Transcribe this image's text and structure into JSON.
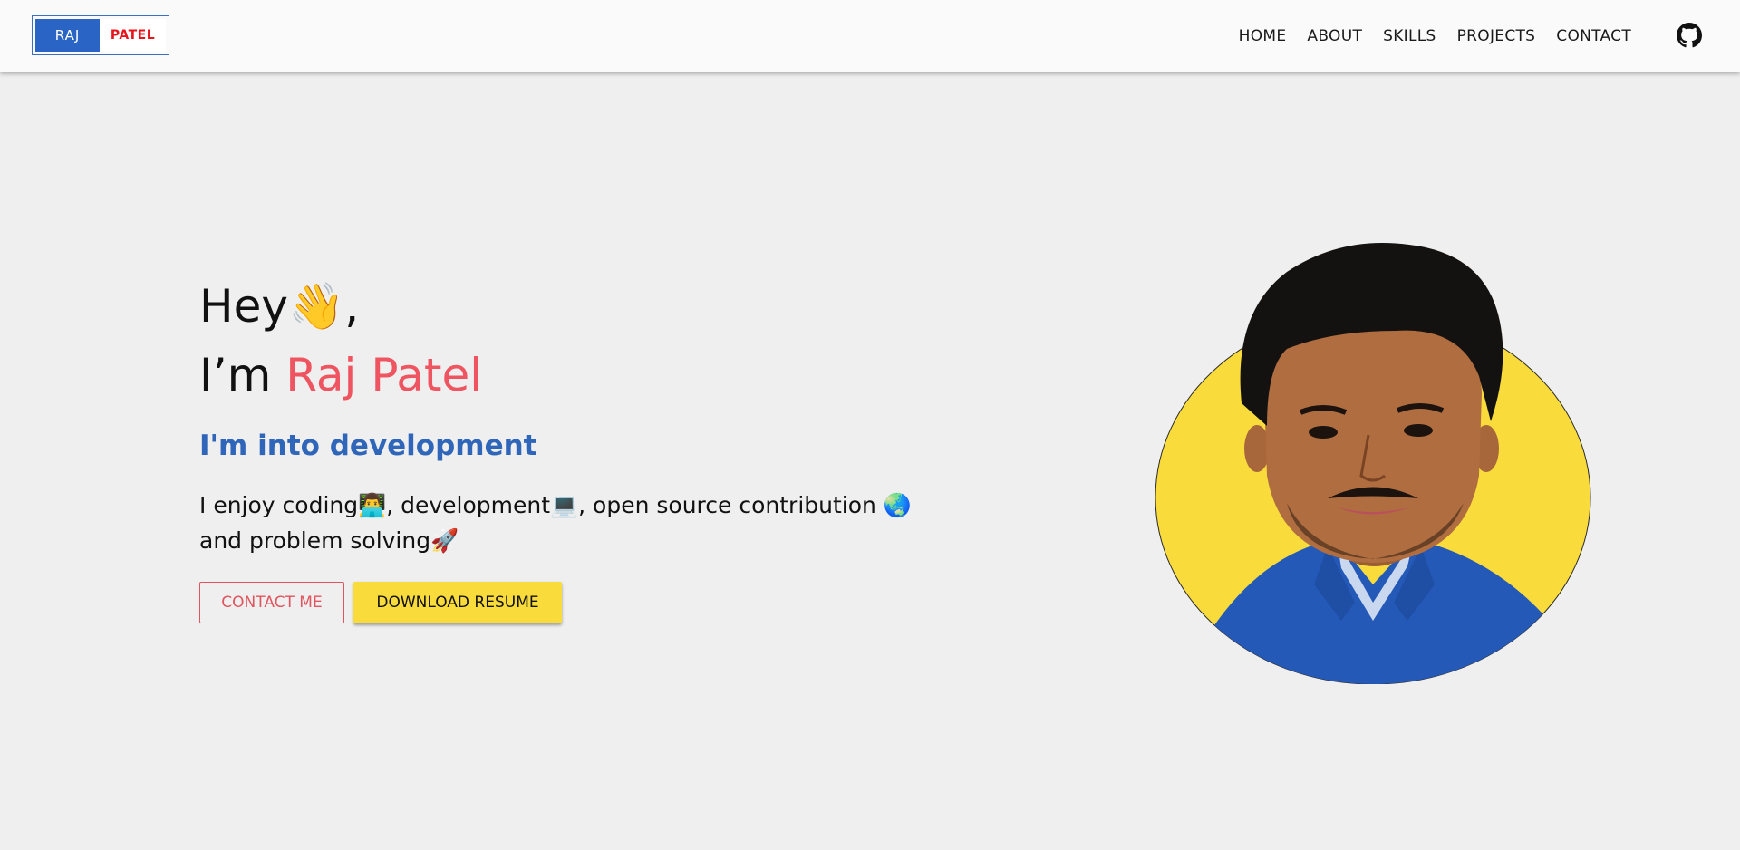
{
  "header": {
    "logo": {
      "left": "RAJ",
      "right": "PATEL"
    },
    "nav": [
      "HOME",
      "ABOUT",
      "SKILLS",
      "PROJECTS",
      "CONTACT"
    ],
    "github_icon": "github-icon"
  },
  "hero": {
    "greeting": "Hey",
    "greeting_emoji": "👋",
    "greeting_suffix": ",",
    "intro_prefix": "I’m ",
    "name": "Raj Patel",
    "tagline": "I'm into development",
    "description": "I enjoy coding👨‍💻, development💻, open source contribution 🌏 and problem solving🚀",
    "buttons": {
      "contact": "CONTACT ME",
      "resume": "DOWNLOAD RESUME"
    }
  },
  "colors": {
    "background": "#efefef",
    "header": "#fafafa",
    "logo_blue": "#2a65c5",
    "logo_red": "#e8141b",
    "name": "#ef5461",
    "tagline": "#2f66b9",
    "contact_button": "#e0555f",
    "resume_button": "#f9dc3c",
    "portrait_circle": "#f9dc3c"
  }
}
